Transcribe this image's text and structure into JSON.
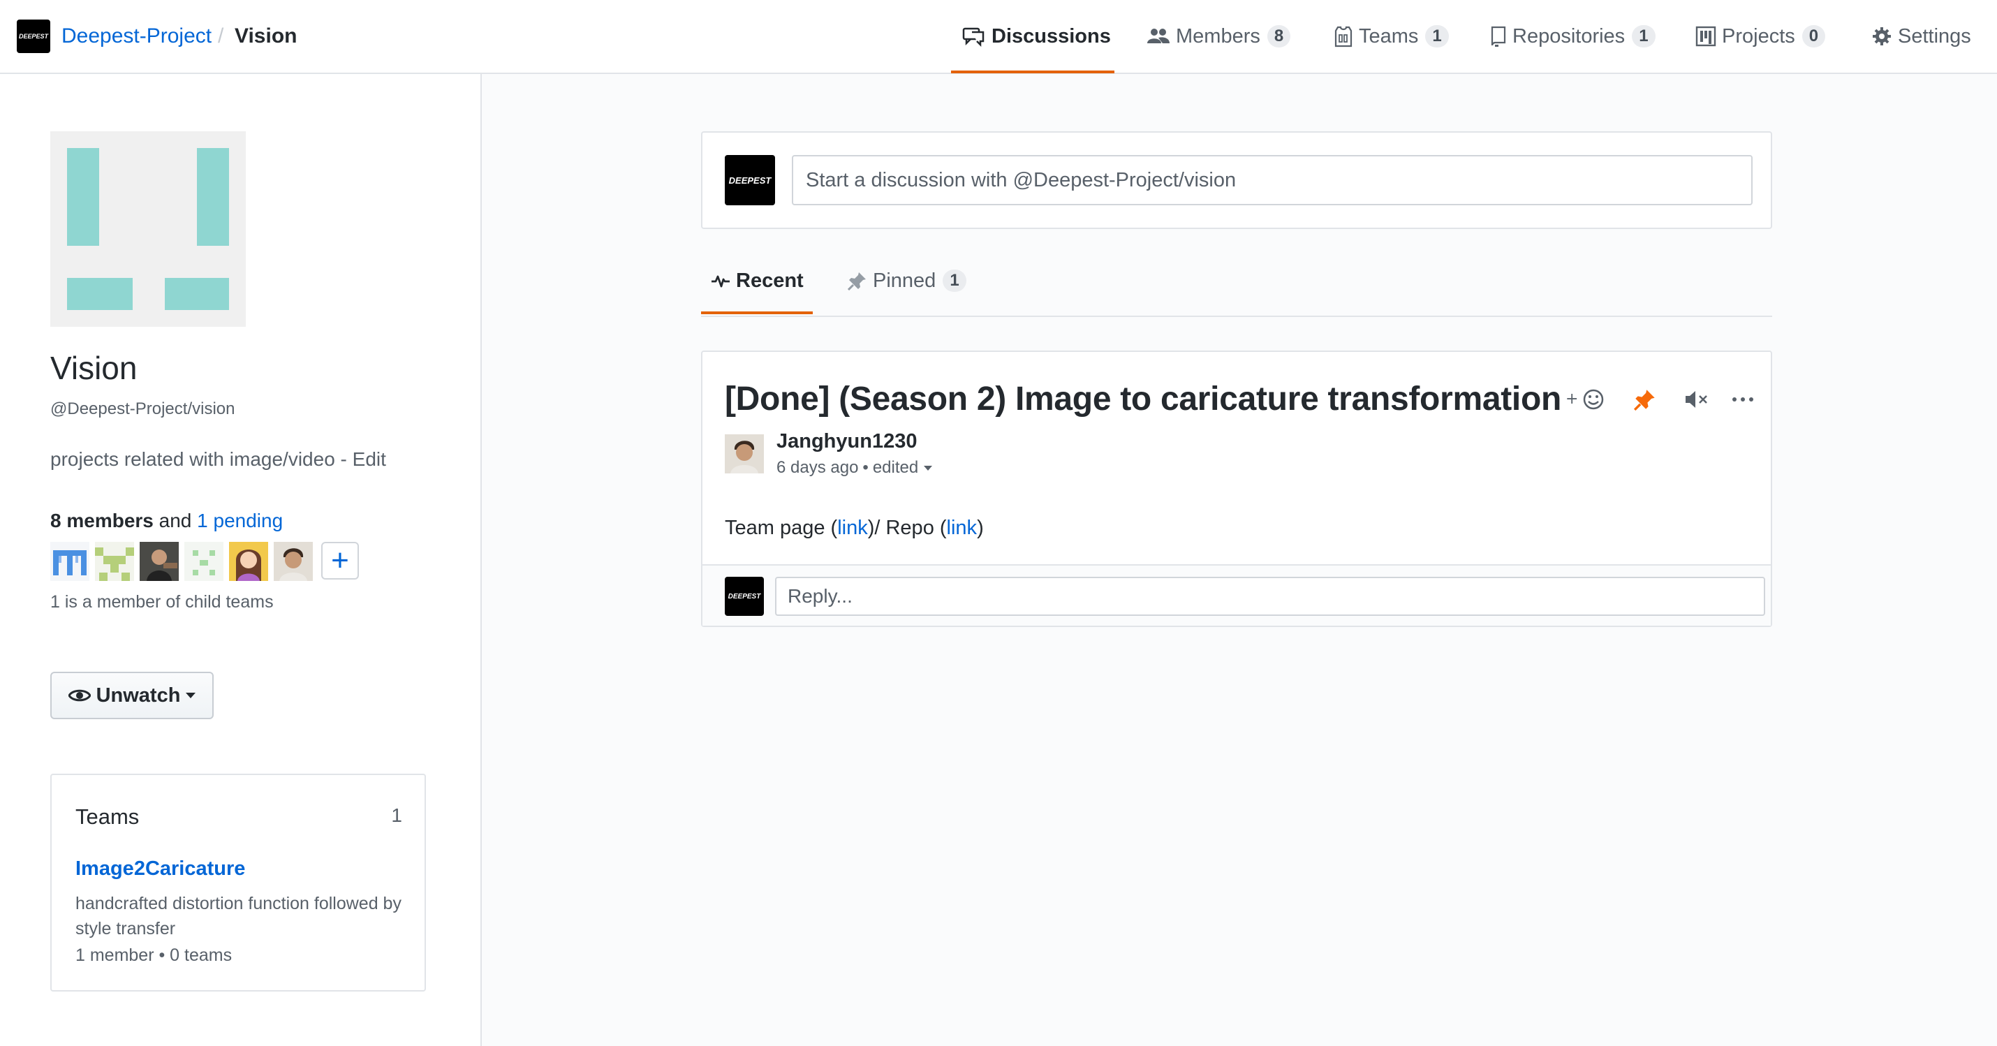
{
  "header": {
    "logo_text": "DEEPEST",
    "org": "Deepest-Project",
    "separator": "/",
    "team": "Vision",
    "nav": [
      {
        "label": "Discussions",
        "icon": "comment-discussion-icon",
        "active": true
      },
      {
        "label": "Members",
        "icon": "people-icon",
        "count": "8"
      },
      {
        "label": "Teams",
        "icon": "jersey-icon",
        "count": "1"
      },
      {
        "label": "Repositories",
        "icon": "repo-icon",
        "count": "1"
      },
      {
        "label": "Projects",
        "icon": "project-icon",
        "count": "0"
      },
      {
        "label": "Settings",
        "icon": "gear-icon"
      }
    ]
  },
  "sidebar": {
    "team_name": "Vision",
    "team_slug": "@Deepest-Project/vision",
    "description": "projects related with image/video - Edit",
    "members_count_text": "8 members",
    "members_and": "and",
    "pending_link": "1 pending",
    "child_team_note": "1 is a member of child teams",
    "unwatch_label": "Unwatch",
    "teams_box": {
      "title": "Teams",
      "count": "1",
      "team_link": "Image2Caricature",
      "team_desc": "handcrafted distortion function followed by style transfer",
      "team_meta": "1 member • 0 teams"
    }
  },
  "composer": {
    "logo_text": "DEEPEST",
    "placeholder": "Start a discussion with @Deepest-Project/vision"
  },
  "tabs": [
    {
      "label": "Recent",
      "icon": "pulse-icon",
      "active": true
    },
    {
      "label": "Pinned",
      "icon": "pin-icon",
      "count": "1"
    }
  ],
  "post": {
    "title": "[Done] (Season 2) Image to caricature transformation",
    "author": "Janghyun1230",
    "time": "6 days ago",
    "dot": "•",
    "edited": "edited",
    "body_prefix": "Team page (",
    "link1": "link",
    "body_mid": ")/ Repo (",
    "link2": "link",
    "body_suffix": ")",
    "reply_placeholder": "Reply...",
    "reply_logo_text": "DEEPEST"
  },
  "colors": {
    "accent": "#e36209",
    "link": "#0366d6",
    "team_avatar": "#8fd6d1",
    "pin": "#f66a0a"
  }
}
